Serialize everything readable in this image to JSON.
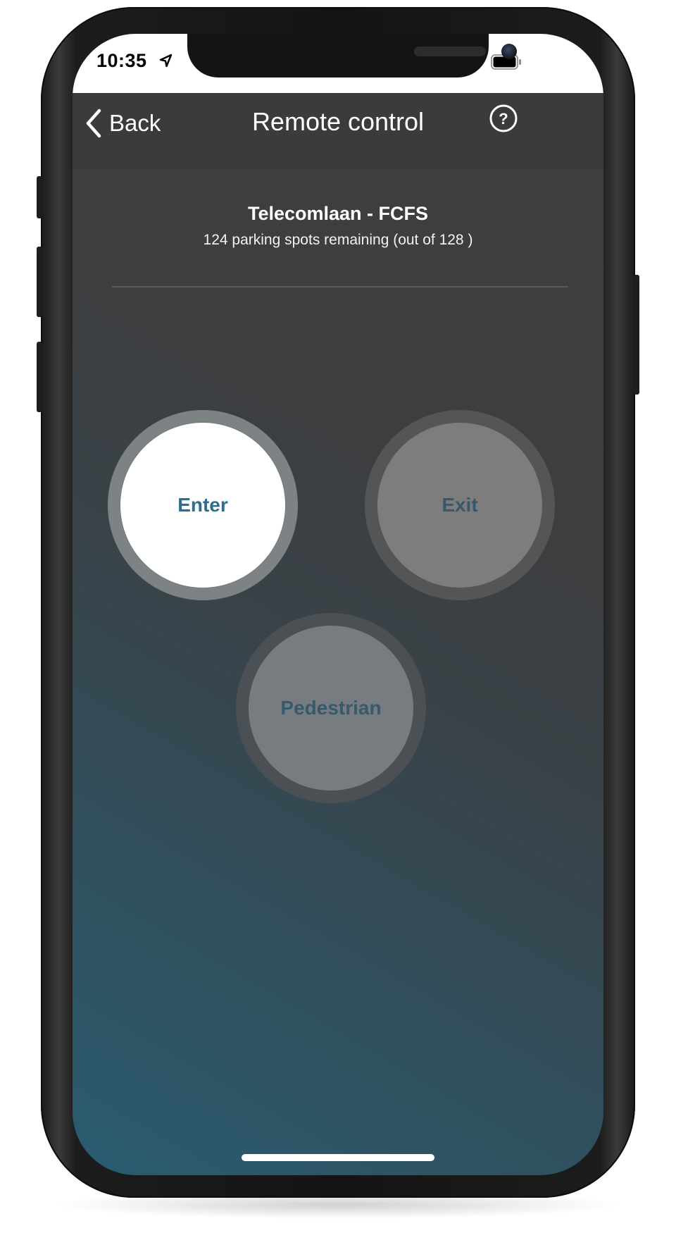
{
  "status_bar": {
    "time": "10:35",
    "icons": [
      "location-arrow-icon",
      "cellular-signal-icon",
      "wifi-icon",
      "battery-icon"
    ]
  },
  "navbar": {
    "back_label": "Back",
    "title": "Remote control",
    "help_icon": "help-circle-icon"
  },
  "location": {
    "name": "Telecomlaan - FCFS",
    "spots_text": "124 parking spots remaining (out of 128 )"
  },
  "controls": {
    "enter_label": "Enter",
    "exit_label": "Exit",
    "pedestrian_label": "Pedestrian"
  },
  "colors": {
    "accent_text": "#2d6e8e",
    "navbar_bg": "#3b3b3b",
    "gradient_bottom": "#2a5c70",
    "gradient_top": "#3e3e3e"
  }
}
